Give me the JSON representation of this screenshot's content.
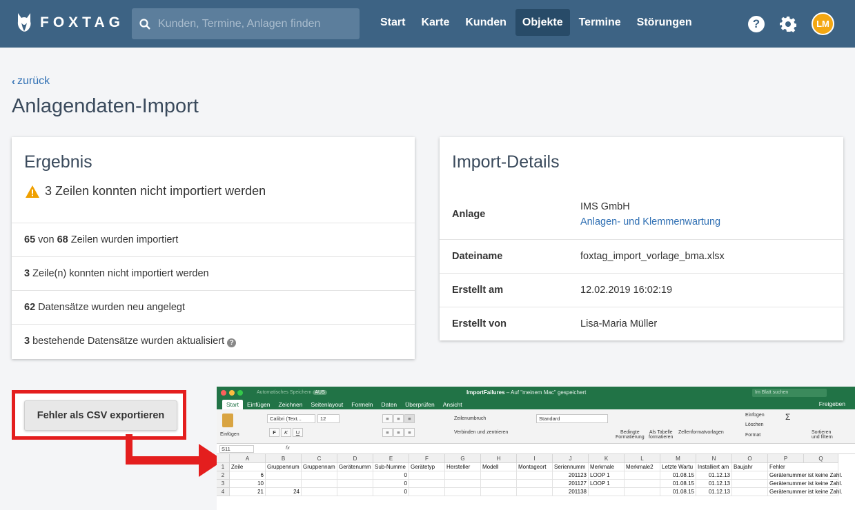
{
  "nav": {
    "logo_text": "FOXTAG",
    "search_placeholder": "Kunden, Termine, Anlagen finden",
    "items": [
      "Start",
      "Karte",
      "Kunden",
      "Objekte",
      "Termine",
      "Störungen"
    ],
    "active_item": "Objekte",
    "avatar_initials": "LM",
    "help_label": "?",
    "colors": {
      "bar": "#3d6384",
      "active": "#284b68",
      "avatar": "#f3a712"
    }
  },
  "page": {
    "back_label": "zurück",
    "title": "Anlagendaten-Import"
  },
  "result": {
    "title": "Ergebnis",
    "warning": "3 Zeilen konnten nicht importiert werden",
    "rows": [
      {
        "bold": "65",
        "mid": " von ",
        "bold2": "68",
        "text": " Zeilen wurden importiert"
      },
      {
        "bold": "3",
        "mid": "",
        "bold2": "",
        "text": " Zeile(n) konnten nicht importiert werden"
      },
      {
        "bold": "62",
        "mid": "",
        "bold2": "",
        "text": " Datensätze wurden neu angelegt"
      },
      {
        "bold": "3",
        "mid": "",
        "bold2": "",
        "text": " bestehende Datensätze wurden aktualisiert"
      }
    ],
    "info_label": "?"
  },
  "details": {
    "title": "Import-Details",
    "anlage_label": "Anlage",
    "anlage_company": "IMS GmbH",
    "anlage_link": "Anlagen- und Klemmenwartung",
    "dateiname_label": "Dateiname",
    "dateiname_value": "foxtag_import_vorlage_bma.xlsx",
    "erstellt_am_label": "Erstellt am",
    "erstellt_am_value": "12.02.2019 16:02:19",
    "erstellt_von_label": "Erstellt von",
    "erstellt_von_value": "Lisa-Maria Müller"
  },
  "export_button": "Fehler als CSV exportieren",
  "excel": {
    "autosave": "Automatisches Speichern",
    "autosave_state": "AUS",
    "file_name": "ImportFailures",
    "file_suffix": " – Auf \"meinem Mac\" gespeichert",
    "search_placeholder": "Im Blatt suchen",
    "tabs": [
      "Start",
      "Einfügen",
      "Zeichnen",
      "Seitenlayout",
      "Formeln",
      "Daten",
      "Überprüfen",
      "Ansicht"
    ],
    "share": "Freigeben",
    "ribbon": {
      "paste": "Einfügen",
      "font": "Calibri (Text...",
      "font_size": "12",
      "wrap": "Zeilenumbruch",
      "merge": "Verbinden und zentrieren",
      "number_format": "Standard",
      "cond_format_1": "Bedingte",
      "cond_format_2": "Formatierung",
      "as_table_1": "Als Tabelle",
      "as_table_2": "formatieren",
      "cell_styles": "Zellenformatvorlagen",
      "insert": "Einfügen",
      "delete": "Löschen",
      "format": "Format",
      "sort_1": "Sortieren",
      "sort_2": "und filtern"
    },
    "cell_ref": "S11",
    "fx": "fx",
    "columns": [
      "A",
      "B",
      "C",
      "D",
      "E",
      "F",
      "G",
      "H",
      "I",
      "J",
      "K",
      "L",
      "M",
      "N",
      "O",
      "P",
      "Q"
    ],
    "row_numbers": [
      "1",
      "2",
      "3",
      "4"
    ],
    "header_row": [
      "Zeile",
      "Gruppennum",
      "Gruppennam",
      "Gerätenumm",
      "Sub-Numme",
      "Gerätetyp",
      "Hersteller",
      "Modell",
      "Montageort",
      "Seriennumm",
      "Merkmale",
      "Merkmale2",
      "Letzte Wartu",
      "Installiert am",
      "Baujahr",
      "Fehler",
      ""
    ],
    "data_rows": [
      [
        "6",
        "",
        "",
        "",
        "0",
        "",
        "",
        "",
        "",
        "201123",
        "LOOP 1",
        "",
        "01.08.15",
        "01.12.13",
        "",
        "Gerätenummer ist keine Zahl.",
        ""
      ],
      [
        "10",
        "",
        "",
        "",
        "0",
        "",
        "",
        "",
        "",
        "201127",
        "LOOP 1",
        "",
        "01.08.15",
        "01.12.13",
        "",
        "Gerätenummer ist keine Zahl.",
        ""
      ],
      [
        "21",
        "24",
        "",
        "",
        "0",
        "",
        "",
        "",
        "",
        "201138",
        "",
        "",
        "01.08.15",
        "01.12.13",
        "",
        "Gerätenummer ist keine Zahl.",
        ""
      ]
    ]
  }
}
